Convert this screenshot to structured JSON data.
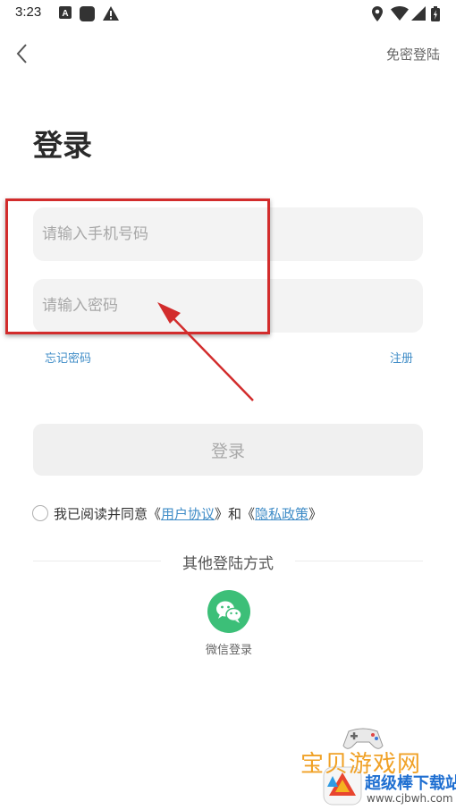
{
  "status_bar": {
    "time": "3:23",
    "left_icons": [
      "font-a-icon",
      "app-square-icon",
      "warning-icon"
    ],
    "right_icons": [
      "location-icon",
      "wifi-icon",
      "signal-icon",
      "battery-icon"
    ]
  },
  "header": {
    "back_icon": "chevron-left-icon",
    "password_free_login": "免密登陆"
  },
  "page_title": "登录",
  "form": {
    "phone_placeholder": "请输入手机号码",
    "password_placeholder": "请输入密码",
    "forgot_password": "忘记密码",
    "register": "注册",
    "login_button": "登录"
  },
  "agreement": {
    "prefix": "我已阅读并同意《",
    "user_agreement": "用户协议",
    "middle": "》和《",
    "privacy_policy": "隐私政策",
    "suffix": "》"
  },
  "other_login": {
    "title": "其他登陆方式",
    "wechat_label": "微信登录",
    "wechat_icon": "wechat-icon"
  },
  "annotation": {
    "color": "#d22c2c"
  },
  "watermark": {
    "title": "宝贝游戏网",
    "subtitle": "超级棒下载站",
    "url": "www.cjbwh.com"
  },
  "colors": {
    "link": "#3f8cc7",
    "wechat_green": "#3cbf78",
    "input_bg": "#f3f3f3"
  }
}
